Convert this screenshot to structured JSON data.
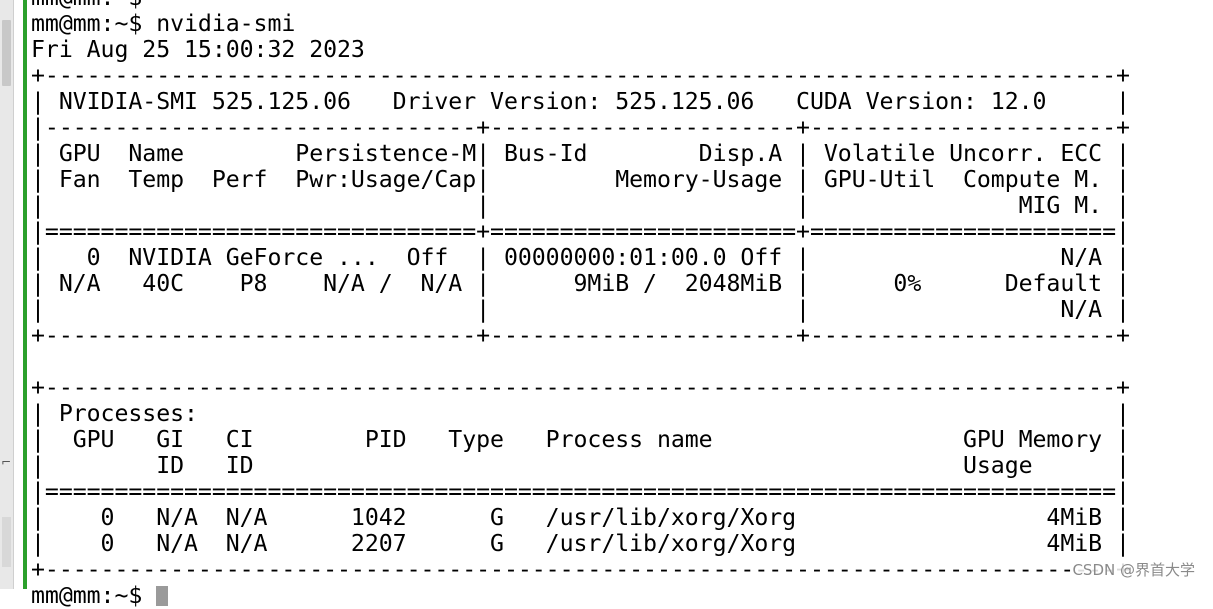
{
  "terminal": {
    "lines": [
      "mm@mm:~$",
      "mm@mm:~$ nvidia-smi",
      "Fri Aug 25 15:00:32 2023",
      "+-----------------------------------------------------------------------------+",
      "| NVIDIA-SMI 525.125.06   Driver Version: 525.125.06   CUDA Version: 12.0     |",
      "|-------------------------------+----------------------+----------------------+",
      "| GPU  Name        Persistence-M| Bus-Id        Disp.A | Volatile Uncorr. ECC |",
      "| Fan  Temp  Perf  Pwr:Usage/Cap|         Memory-Usage | GPU-Util  Compute M. |",
      "|                               |                      |               MIG M. |",
      "|===============================+======================+======================|",
      "|   0  NVIDIA GeForce ...  Off  | 00000000:01:00.0 Off |                  N/A |",
      "| N/A   40C    P8    N/A /  N/A |      9MiB /  2048MiB |      0%      Default |",
      "|                               |                      |                  N/A |",
      "+-------------------------------+----------------------+----------------------+",
      "",
      "+-----------------------------------------------------------------------------+",
      "| Processes:                                                                  |",
      "|  GPU   GI   CI        PID   Type   Process name                  GPU Memory |",
      "|        ID   ID                                                   Usage      |",
      "|=============================================================================|",
      "|    0   N/A  N/A      1042      G   /usr/lib/xorg/Xorg                  4MiB |",
      "|    0   N/A  N/A      2207      G   /usr/lib/xorg/Xorg                  4MiB |",
      "+-----------------------------------------------------------------------------+"
    ],
    "final_prompt": "mm@mm:~$ "
  },
  "watermark": "CSDN @界首大学"
}
